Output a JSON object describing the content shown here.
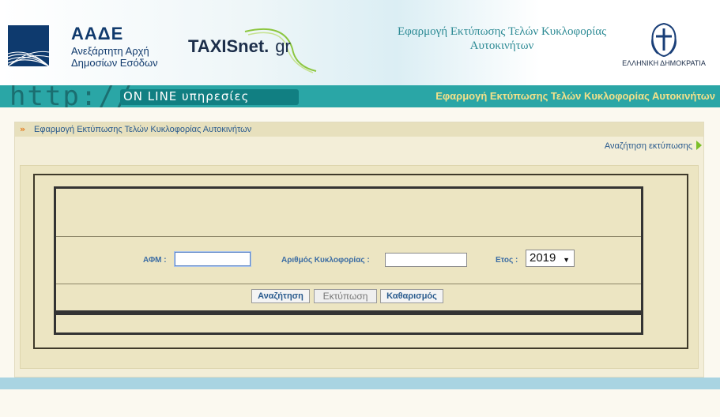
{
  "header": {
    "aade_name": "ΑΑΔΕ",
    "aade_sub1": "Ανεξάρτητη Αρχή",
    "aade_sub2": "Δημοσίων Εσόδων",
    "taxisnet_main": "TAXISnet",
    "taxisnet_gr": "gr",
    "app_title_line1": "Εφαρμογή Εκτύπωσης Τελών Κυκλοφορίας",
    "app_title_line2": "Αυτοκινήτων",
    "republic": "ΕΛΛΗΝΙΚΗ ΔΗΜΟΚΡΑΤΙΑ"
  },
  "banner": {
    "http": "http://w",
    "online": "ON LINE υπηρεσίες",
    "title": "Εφαρμογή Εκτύπωσης Τελών Κυκλοφορίας Αυτοκινήτων"
  },
  "panel": {
    "heading": "Εφαρμογή Εκτύπωσης Τελών Κυκλοφορίας Αυτοκινήτων",
    "search_link": "Αναζήτηση εκτύπωσης"
  },
  "form": {
    "afm_label": "ΑΦΜ :",
    "afm_value": "",
    "plate_label": "Αριθμός Κυκλοφορίας :",
    "plate_value": "",
    "year_label": "Ετος :",
    "year_selected": "2019"
  },
  "buttons": {
    "search": "Αναζήτηση",
    "print": "Εκτύπωση",
    "clear": "Καθαρισμός"
  },
  "colors": {
    "teal_bar": "#2aa6a6",
    "link_blue": "#2a5b8e",
    "panel_bg": "#ece5c2"
  }
}
